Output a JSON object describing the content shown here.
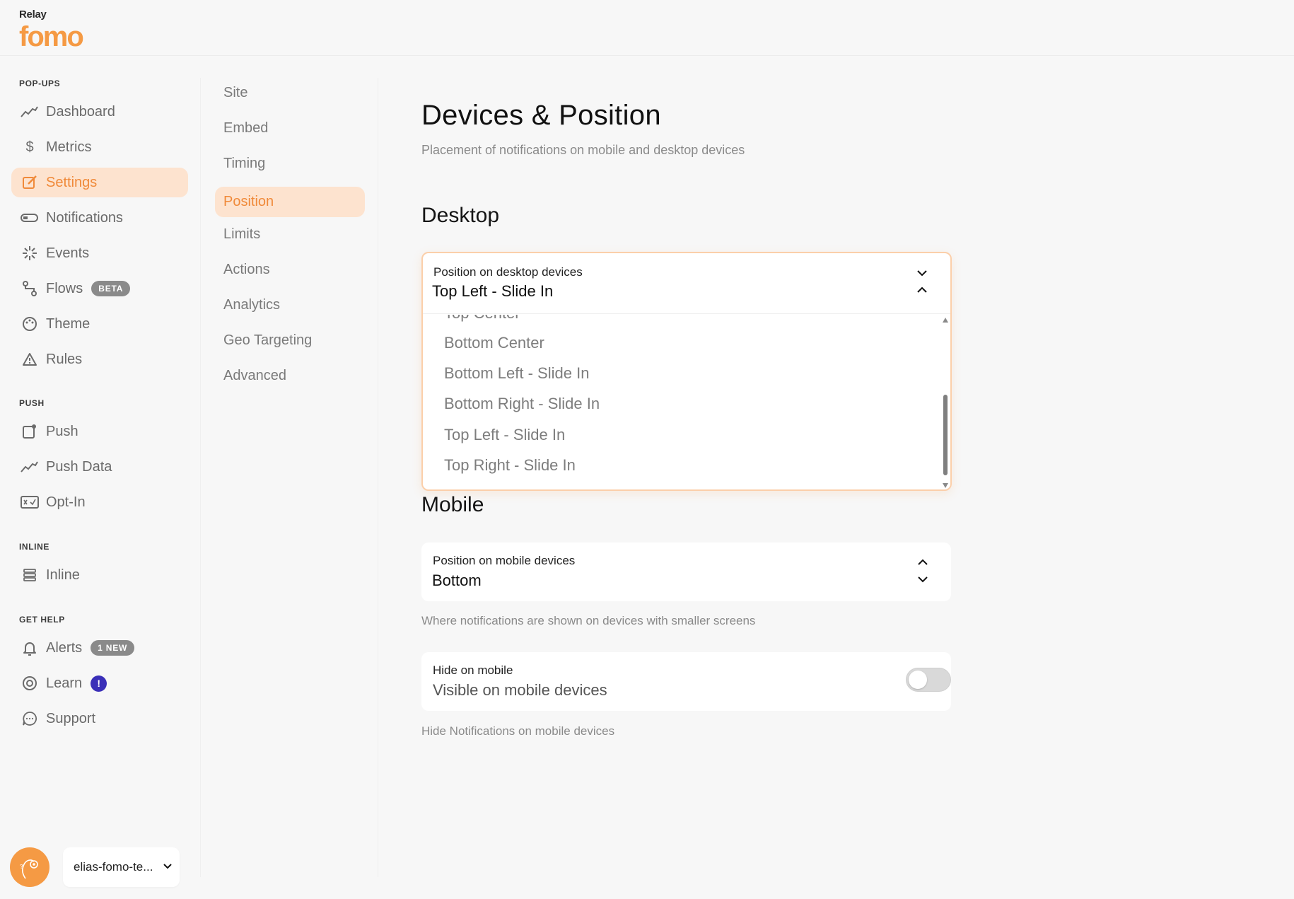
{
  "brand": {
    "top": "Relay",
    "main": "FOMO",
    "accent_color": "#f59a44"
  },
  "sidebar": {
    "sections": [
      {
        "label": "POP-UPS"
      },
      {
        "label": "PUSH"
      },
      {
        "label": "INLINE"
      },
      {
        "label": "GET HELP"
      }
    ],
    "items": [
      {
        "label": "Dashboard",
        "icon": "chart-line-icon"
      },
      {
        "label": "Metrics",
        "icon": "dollar-icon"
      },
      {
        "label": "Settings",
        "icon": "edit-icon",
        "active": true
      },
      {
        "label": "Notifications",
        "icon": "toggle-icon"
      },
      {
        "label": "Events",
        "icon": "sparkle-icon"
      },
      {
        "label": "Flows",
        "icon": "flow-icon",
        "badge": "BETA"
      },
      {
        "label": "Theme",
        "icon": "palette-icon"
      },
      {
        "label": "Rules",
        "icon": "warning-icon"
      },
      {
        "label": "Push",
        "icon": "push-icon"
      },
      {
        "label": "Push Data",
        "icon": "chart-line-icon"
      },
      {
        "label": "Opt-In",
        "icon": "optin-icon"
      },
      {
        "label": "Inline",
        "icon": "inline-icon"
      },
      {
        "label": "Alerts",
        "icon": "bell-icon",
        "badge": "1 NEW"
      },
      {
        "label": "Learn",
        "icon": "lifebuoy-icon",
        "badge": "!"
      },
      {
        "label": "Support",
        "icon": "chat-icon"
      }
    ]
  },
  "account": {
    "name": "elias-fomo-te..."
  },
  "subnav": {
    "items": [
      {
        "label": "Site"
      },
      {
        "label": "Embed"
      },
      {
        "label": "Timing"
      },
      {
        "label": "Position",
        "active": true
      },
      {
        "label": "Limits"
      },
      {
        "label": "Actions"
      },
      {
        "label": "Analytics"
      },
      {
        "label": "Geo Targeting"
      },
      {
        "label": "Advanced"
      }
    ]
  },
  "main": {
    "title": "Devices & Position",
    "subtitle": "Placement of notifications on mobile and desktop devices",
    "desktop": {
      "heading": "Desktop",
      "field_label": "Position on desktop devices",
      "value": "Top Left - Slide In",
      "options": [
        "Top Center",
        "Bottom Center",
        "Bottom Left - Slide In",
        "Bottom Right - Slide In",
        "Top Left - Slide In",
        "Top Right - Slide In"
      ]
    },
    "mobile": {
      "heading": "Mobile",
      "field_label": "Position on mobile devices",
      "value": "Bottom",
      "helper": "Where notifications are shown on devices with smaller screens"
    },
    "hide_mobile": {
      "label": "Hide on mobile",
      "value": "Visible on mobile devices",
      "enabled": false,
      "helper": "Hide Notifications on mobile devices"
    }
  }
}
